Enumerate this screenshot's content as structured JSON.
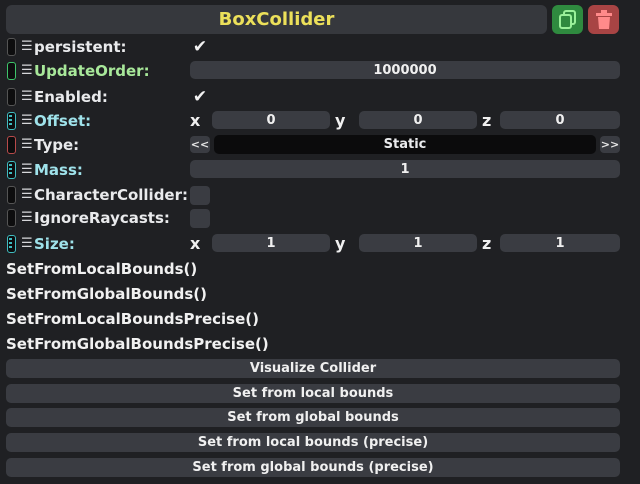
{
  "header": {
    "title": "BoxCollider",
    "duplicate_icon": "copy-icon",
    "delete_icon": "trash-icon"
  },
  "properties": {
    "persistent": {
      "label": "persistent:",
      "checked": true
    },
    "update_order": {
      "label": "UpdateOrder:",
      "value": "1000000"
    },
    "enabled": {
      "label": "Enabled:",
      "checked": true
    },
    "offset": {
      "label": "Offset:",
      "x_label": "x",
      "y_label": "y",
      "z_label": "z",
      "x": "0",
      "y": "0",
      "z": "0"
    },
    "type": {
      "label": "Type:",
      "value": "Static",
      "prev": "<<",
      "next": ">>"
    },
    "mass": {
      "label": "Mass:",
      "value": "1"
    },
    "character_collider": {
      "label": "CharacterCollider:",
      "checked": false
    },
    "ignore_raycasts": {
      "label": "IgnoreRaycasts:",
      "checked": false
    },
    "size": {
      "label": "Size:",
      "x_label": "x",
      "y_label": "y",
      "z_label": "z",
      "x": "1",
      "y": "1",
      "z": "1"
    }
  },
  "methods": [
    "SetFromLocalBounds()",
    "SetFromGlobalBounds()",
    "SetFromLocalBoundsPrecise()",
    "SetFromGlobalBoundsPrecise()"
  ],
  "buttons": [
    "Visualize Collider",
    "Set from local bounds",
    "Set from global bounds",
    "Set from local bounds (precise)",
    "Set from global bounds (precise)"
  ],
  "colors": {
    "background": "#1f2023",
    "title": "#ece05a",
    "duplicate": "#2f8a3f",
    "delete": "#a84444"
  }
}
